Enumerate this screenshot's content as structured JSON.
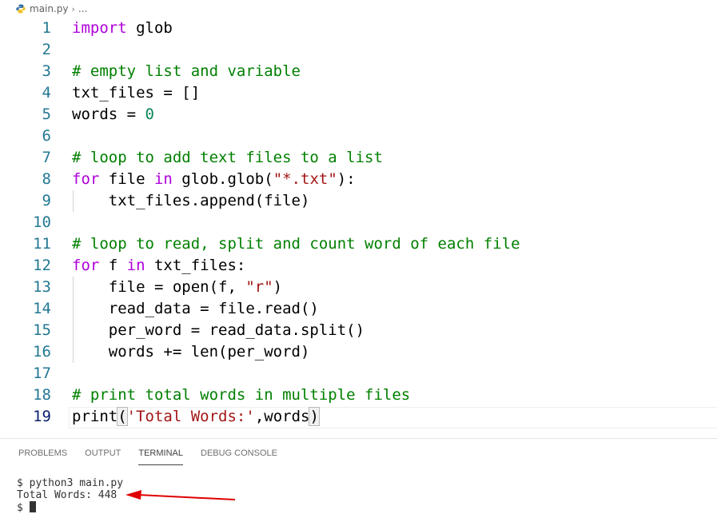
{
  "breadcrumb": {
    "file": "main.py",
    "more": "..."
  },
  "editor": {
    "active_line": 19,
    "lines": [
      {
        "n": "1"
      },
      {
        "n": "2"
      },
      {
        "n": "3"
      },
      {
        "n": "4"
      },
      {
        "n": "5"
      },
      {
        "n": "6"
      },
      {
        "n": "7"
      },
      {
        "n": "8"
      },
      {
        "n": "9"
      },
      {
        "n": "10"
      },
      {
        "n": "11"
      },
      {
        "n": "12"
      },
      {
        "n": "13"
      },
      {
        "n": "14"
      },
      {
        "n": "15"
      },
      {
        "n": "16"
      },
      {
        "n": "17"
      },
      {
        "n": "18"
      },
      {
        "n": "19"
      }
    ],
    "code": {
      "l1": {
        "kw": "import",
        "rest": " glob"
      },
      "l3": "# empty list and variable",
      "l4": "txt_files = []",
      "l5": {
        "a": "words = ",
        "num": "0"
      },
      "l7": "# loop to add text files to a list",
      "l8": {
        "kw": "for",
        "a": " file ",
        "kw2": "in",
        "b": " glob.glob(",
        "str": "\"*.txt\"",
        "c": "):"
      },
      "l9": "    txt_files.append(file)",
      "l11": "# loop to read, split and count word of each file",
      "l12": {
        "kw": "for",
        "a": " f ",
        "kw2": "in",
        "b": " txt_files:"
      },
      "l13": {
        "a": "    file = open(f, ",
        "str": "\"r\"",
        "b": ")"
      },
      "l14": "    read_data = file.read()",
      "l15": "    per_word = read_data.split()",
      "l16": "    words += len(per_word)",
      "l18": "# print total words in multiple files",
      "l19": {
        "a": "print",
        "p1": "(",
        "str": "'Total Words:'",
        "b": ",words",
        "p2": ")"
      }
    }
  },
  "panel": {
    "tabs": [
      "PROBLEMS",
      "OUTPUT",
      "TERMINAL",
      "DEBUG CONSOLE"
    ],
    "active_tab": "TERMINAL"
  },
  "terminal": {
    "line1": "$ python3 main.py",
    "line2": "Total Words: 448",
    "prompt": "$ "
  },
  "colors": {
    "keyword": "#af00db",
    "comment": "#008000",
    "string": "#a31515",
    "number": "#098658",
    "line_number": "#237893",
    "arrow": "#e00000"
  }
}
